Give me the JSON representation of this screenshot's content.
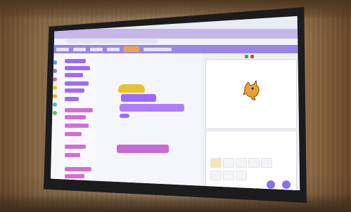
{
  "scene": {
    "subject": "",
    "colors": {
      "wall": "#a78a66",
      "screen_frame": "#1c1b1d",
      "screen_bg": "#e9ecf3",
      "scratch_menu": "#9a86e6",
      "scratch_top": "#c5b7ea",
      "block_purple": "#9b6bff",
      "block_pink": "#d36ed6",
      "block_yellow": "#e8c12c",
      "sprite_orange": "#e8a234",
      "flag_green": "#43b02a",
      "stop_red": "#e0453a"
    }
  },
  "screen_content": {
    "app_icon": "scratch-editor",
    "menu_highlight_icon": "orange-menu-button",
    "stage_icon": "cat-sprite-icon"
  }
}
